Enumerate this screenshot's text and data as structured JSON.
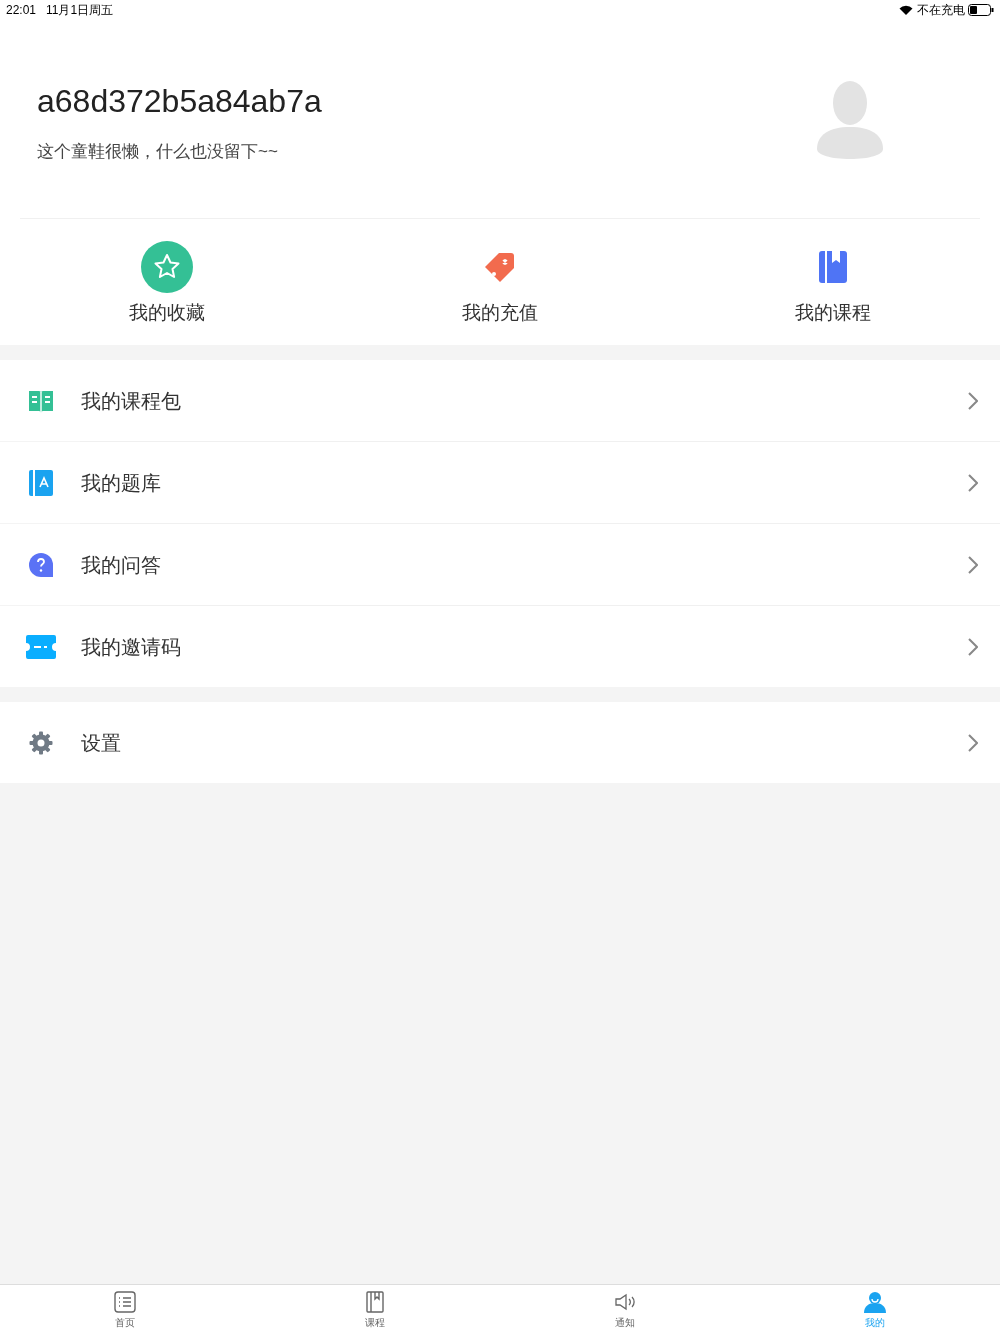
{
  "status_bar": {
    "time": "22:01",
    "date": "11月1日周五",
    "charging": "不在充电"
  },
  "profile": {
    "username": "a68d372b5a84ab7a",
    "bio": "这个童鞋很懒，什么也没留下~~"
  },
  "shortcuts": [
    "我的收藏",
    "我的充值",
    "我的课程"
  ],
  "menu": [
    "我的课程包",
    "我的题库",
    "我的问答",
    "我的邀请码"
  ],
  "settings_menu": [
    "设置"
  ],
  "tabs": [
    {
      "label": "首页",
      "selected": false
    },
    {
      "label": "课程",
      "selected": false
    },
    {
      "label": "通知",
      "selected": false
    },
    {
      "label": "我的",
      "selected": true
    }
  ]
}
